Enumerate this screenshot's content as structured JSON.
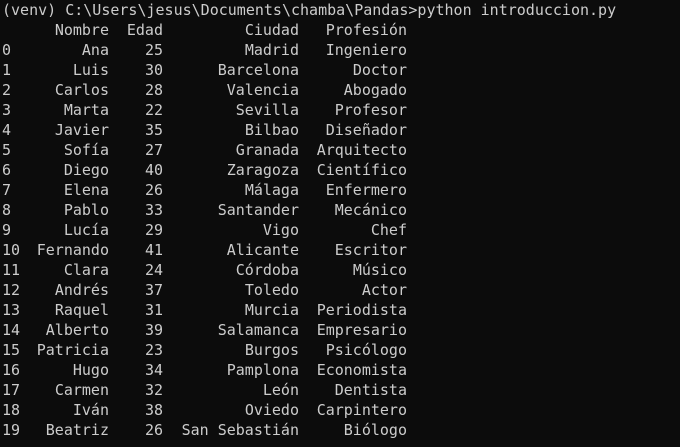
{
  "terminal": {
    "prompt": "(venv) C:\\Users\\jesus\\Documents\\chamba\\Pandas>",
    "command": "python introduccion.py",
    "headers": {
      "index": "",
      "nombre": "Nombre",
      "edad": "Edad",
      "ciudad": "Ciudad",
      "profesion": "Profesión"
    },
    "rows": [
      {
        "index": "0",
        "nombre": "Ana",
        "edad": "25",
        "ciudad": "Madrid",
        "profesion": "Ingeniero"
      },
      {
        "index": "1",
        "nombre": "Luis",
        "edad": "30",
        "ciudad": "Barcelona",
        "profesion": "Doctor"
      },
      {
        "index": "2",
        "nombre": "Carlos",
        "edad": "28",
        "ciudad": "Valencia",
        "profesion": "Abogado"
      },
      {
        "index": "3",
        "nombre": "Marta",
        "edad": "22",
        "ciudad": "Sevilla",
        "profesion": "Profesor"
      },
      {
        "index": "4",
        "nombre": "Javier",
        "edad": "35",
        "ciudad": "Bilbao",
        "profesion": "Diseñador"
      },
      {
        "index": "5",
        "nombre": "Sofía",
        "edad": "27",
        "ciudad": "Granada",
        "profesion": "Arquitecto"
      },
      {
        "index": "6",
        "nombre": "Diego",
        "edad": "40",
        "ciudad": "Zaragoza",
        "profesion": "Científico"
      },
      {
        "index": "7",
        "nombre": "Elena",
        "edad": "26",
        "ciudad": "Málaga",
        "profesion": "Enfermero"
      },
      {
        "index": "8",
        "nombre": "Pablo",
        "edad": "33",
        "ciudad": "Santander",
        "profesion": "Mecánico"
      },
      {
        "index": "9",
        "nombre": "Lucía",
        "edad": "29",
        "ciudad": "Vigo",
        "profesion": "Chef"
      },
      {
        "index": "10",
        "nombre": "Fernando",
        "edad": "41",
        "ciudad": "Alicante",
        "profesion": "Escritor"
      },
      {
        "index": "11",
        "nombre": "Clara",
        "edad": "24",
        "ciudad": "Córdoba",
        "profesion": "Músico"
      },
      {
        "index": "12",
        "nombre": "Andrés",
        "edad": "37",
        "ciudad": "Toledo",
        "profesion": "Actor"
      },
      {
        "index": "13",
        "nombre": "Raquel",
        "edad": "31",
        "ciudad": "Murcia",
        "profesion": "Periodista"
      },
      {
        "index": "14",
        "nombre": "Alberto",
        "edad": "39",
        "ciudad": "Salamanca",
        "profesion": "Empresario"
      },
      {
        "index": "15",
        "nombre": "Patricia",
        "edad": "23",
        "ciudad": "Burgos",
        "profesion": "Psicólogo"
      },
      {
        "index": "16",
        "nombre": "Hugo",
        "edad": "34",
        "ciudad": "Pamplona",
        "profesion": "Economista"
      },
      {
        "index": "17",
        "nombre": "Carmen",
        "edad": "32",
        "ciudad": "León",
        "profesion": "Dentista"
      },
      {
        "index": "18",
        "nombre": "Iván",
        "edad": "38",
        "ciudad": "Oviedo",
        "profesion": "Carpintero"
      },
      {
        "index": "19",
        "nombre": "Beatriz",
        "edad": "26",
        "ciudad": "San Sebastián",
        "profesion": "Biólogo"
      }
    ]
  },
  "colors": {
    "background": "#0c0c0c",
    "foreground": "#cccccc"
  }
}
